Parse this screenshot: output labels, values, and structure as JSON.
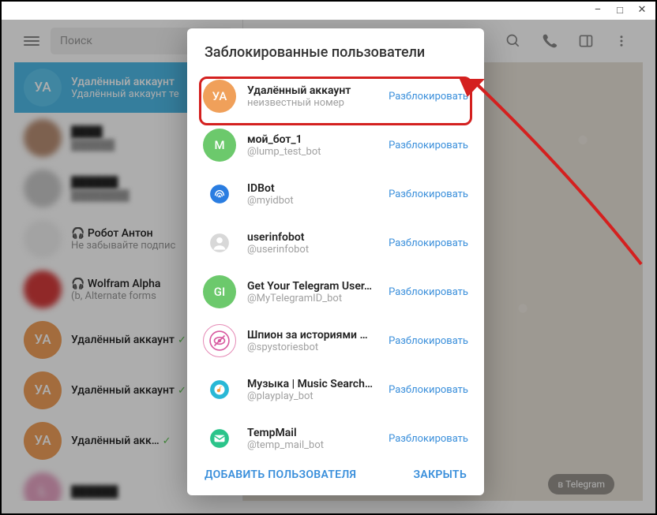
{
  "window": {
    "minimize": "–",
    "maximize": "□",
    "close": "✕"
  },
  "header": {
    "search_placeholder": "Поиск"
  },
  "chats": [
    {
      "name": "Удалённый аккаунт",
      "sub": "Удалённый аккаунт те",
      "initials": "УА",
      "color": "#5fc6ee",
      "selected": true
    },
    {
      "name": "████",
      "sub": "██████",
      "initials": "",
      "color": "#b98f75",
      "blur": true
    },
    {
      "name": "██████",
      "sub": "████████",
      "initials": "",
      "color": "#c9c9c9",
      "blur": true
    },
    {
      "name": "🎧 Робот Антон",
      "sub": "Не забывайте подпис",
      "initials": "",
      "color": "#f0f0f0",
      "imgblur": true
    },
    {
      "name": "🎧 Wolfram Alpha",
      "sub": "(b, Alternate forms",
      "initials": "",
      "color": "#d43c3c",
      "imgblur": true
    },
    {
      "name": "Удалённый аккаунт",
      "sub": "",
      "initials": "УА",
      "color": "#f0a05a",
      "check": true
    },
    {
      "name": "Удалённый аккаунт",
      "sub": "",
      "initials": "УА",
      "color": "#f0a05a",
      "check": true
    },
    {
      "name": "Удалённый акк…",
      "sub": "",
      "initials": "УА",
      "color": "#f0a05a",
      "check": true
    },
    {
      "name": "██████",
      "sub": "",
      "initials": "L",
      "color": "#e6a4c4",
      "blur": true
    }
  ],
  "bottom_pill": "в Telegram",
  "modal": {
    "title": "Заблокированные пользователи",
    "unblock_label": "Разблокировать",
    "items": [
      {
        "name": "Удалённый аккаунт",
        "sub": "неизвестный номер",
        "initials": "УА",
        "color": "#f0a05a"
      },
      {
        "name": "мой_бот_1",
        "sub": "@lump_test_bot",
        "initials": "М",
        "color": "#6cc96c"
      },
      {
        "name": "IDBot",
        "sub": "@myidbot",
        "initials": "",
        "color": "#2a7de1",
        "icon": "fingerprint"
      },
      {
        "name": "userinfobot",
        "sub": "@userinfobot",
        "initials": "",
        "color": "#d8d8d8",
        "icon": "person"
      },
      {
        "name": "Get Your Telegram User…",
        "sub": "@MyTelegramID_bot",
        "initials": "GI",
        "color": "#6cc96c"
      },
      {
        "name": "Шпион за историями …",
        "sub": "@spystoriesbot",
        "initials": "",
        "color": "#ffffff",
        "icon": "eye",
        "border": true
      },
      {
        "name": "Музыка | Music Search…",
        "sub": "@playplay_bot",
        "initials": "",
        "color": "#29b8d6",
        "icon": "music"
      },
      {
        "name": "TempMail",
        "sub": "@temp_mail_bot",
        "initials": "",
        "color": "#2bc48a",
        "icon": "mail"
      }
    ],
    "add_user": "ДОБАВИТЬ ПОЛЬЗОВАТЕЛЯ",
    "close": "ЗАКРЫТЬ"
  }
}
